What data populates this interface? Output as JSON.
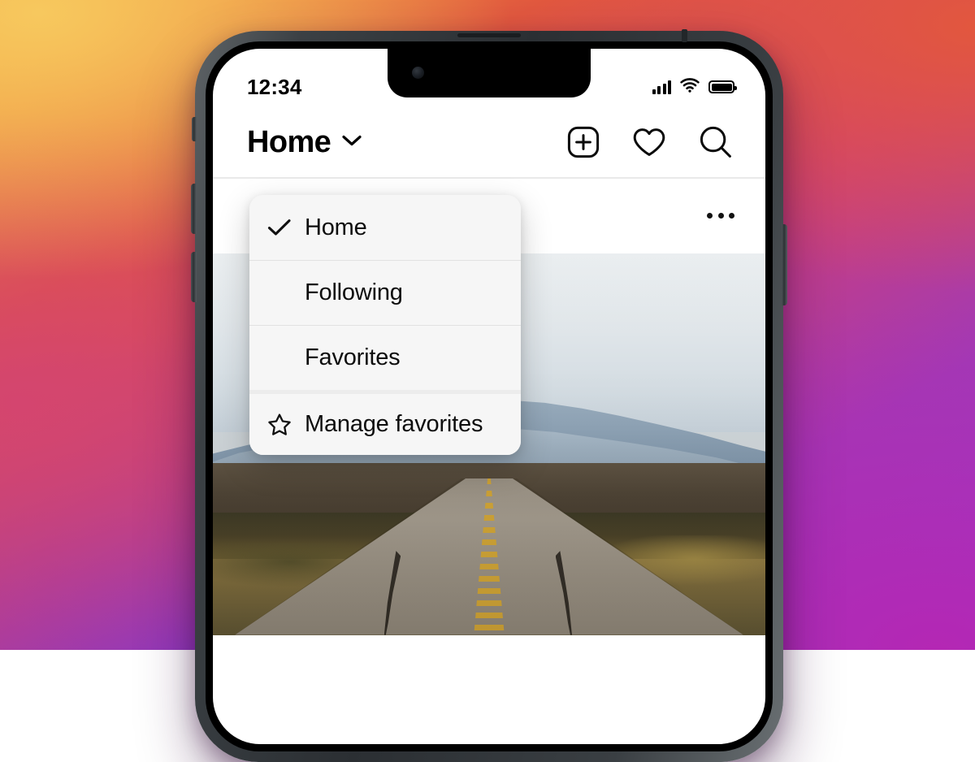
{
  "background": {
    "name": "instagram-brand-gradient",
    "colors": [
      "#F3A73F",
      "#E2583F",
      "#CF3F77",
      "#A13AB5",
      "#9A3BC4"
    ]
  },
  "device": {
    "name": "iphone-mockup",
    "buttons": {
      "silent_switch": "silent-switch",
      "volume_up": "volume-up-button",
      "volume_down": "volume-down-button",
      "power": "power-button"
    }
  },
  "status_bar": {
    "time": "12:34",
    "cellular_icon": "cellular-signal-icon",
    "wifi_icon": "wifi-icon",
    "battery_icon": "battery-full-icon"
  },
  "app_bar": {
    "title": "Home",
    "chevron_icon": "chevron-down-icon",
    "actions": [
      {
        "name": "new-post-button",
        "icon": "plus-square-icon",
        "label": "New post"
      },
      {
        "name": "activity-button",
        "icon": "heart-icon",
        "label": "Activity"
      },
      {
        "name": "search-button",
        "icon": "search-icon",
        "label": "Search"
      }
    ]
  },
  "dropdown": {
    "items": [
      {
        "label": "Home",
        "icon": "check-icon",
        "selected": true,
        "group": 1
      },
      {
        "label": "Following",
        "icon": "",
        "selected": false,
        "group": 1
      },
      {
        "label": "Favorites",
        "icon": "",
        "selected": false,
        "group": 1
      },
      {
        "label": "Manage favorites",
        "icon": "star-icon",
        "selected": false,
        "group": 2
      }
    ]
  },
  "feed": {
    "post": {
      "more_button_icon": "more-horizontal-icon",
      "photo_alt": "desert-highway-with-mountains"
    }
  }
}
